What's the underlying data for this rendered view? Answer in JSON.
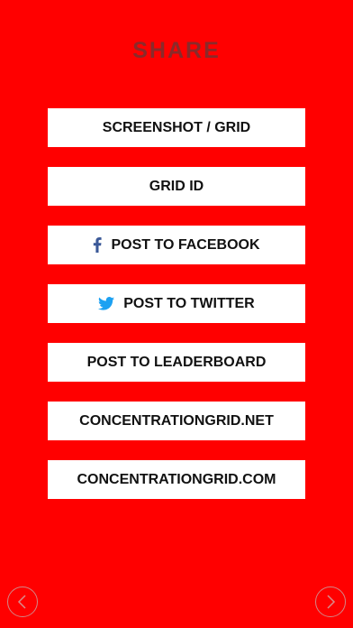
{
  "header": {
    "title": "SHARE"
  },
  "menu": {
    "items": [
      {
        "label": "SCREENSHOT / GRID",
        "icon": null
      },
      {
        "label": "GRID ID",
        "icon": null
      },
      {
        "label": "POST TO FACEBOOK",
        "icon": "facebook-icon"
      },
      {
        "label": "POST TO TWITTER",
        "icon": "twitter-icon"
      },
      {
        "label": "POST TO LEADERBOARD",
        "icon": null
      },
      {
        "label": "CONCENTRATIONGRID.NET",
        "icon": null
      },
      {
        "label": "CONCENTRATIONGRID.COM",
        "icon": null
      }
    ]
  },
  "nav": {
    "previous_icon": "chevron-left-icon",
    "next_icon": "chevron-right-icon"
  },
  "colors": {
    "background": "#ff0000",
    "title": "#8a2a2a",
    "button_bg": "#ffffff",
    "button_text": "#111111",
    "facebook": "#3b5998",
    "twitter": "#1da1f2"
  }
}
